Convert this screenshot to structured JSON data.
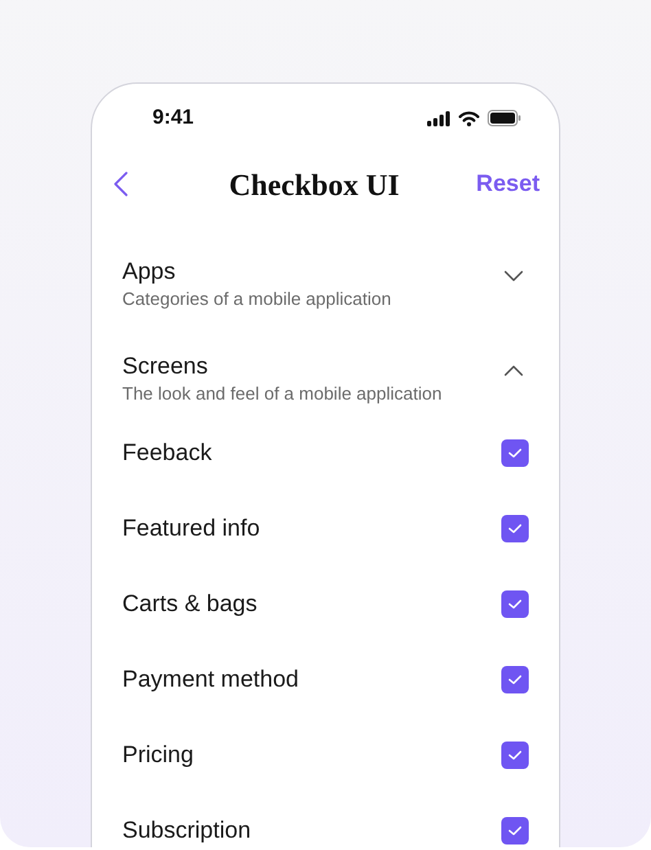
{
  "status_bar": {
    "time": "9:41"
  },
  "header": {
    "title": "Checkbox UI",
    "action": "Reset"
  },
  "sections": [
    {
      "title": "Apps",
      "subtitle": "Categories of a mobile application",
      "expanded": false
    },
    {
      "title": "Screens",
      "subtitle": "The look and feel of a mobile application",
      "expanded": true,
      "items": [
        {
          "label": "Feeback",
          "checked": true
        },
        {
          "label": "Featured info",
          "checked": true
        },
        {
          "label": "Carts & bags",
          "checked": true
        },
        {
          "label": "Payment method",
          "checked": true
        },
        {
          "label": "Pricing",
          "checked": true
        },
        {
          "label": "Subscription",
          "checked": true
        }
      ]
    }
  ]
}
